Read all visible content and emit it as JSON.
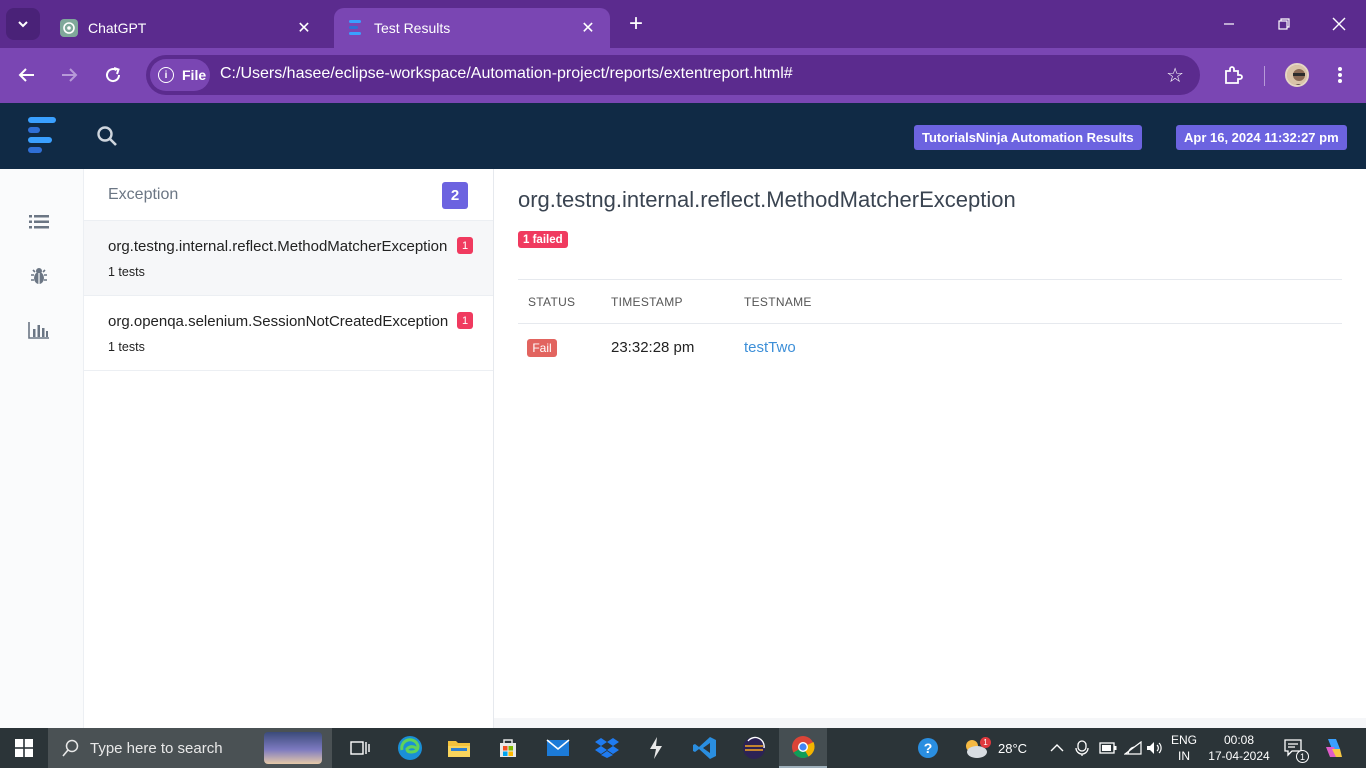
{
  "browser": {
    "tabs": [
      {
        "label": "ChatGPT",
        "active": false
      },
      {
        "label": "Test Results",
        "active": true
      }
    ],
    "site_chip": "File",
    "url": "C:/Users/hasee/eclipse-workspace/Automation-project/reports/extentreport.html#"
  },
  "header": {
    "report_name": "TutorialsNinja Automation Results",
    "timestamp": "Apr 16, 2024 11:32:27 pm"
  },
  "list": {
    "title": "Exception",
    "count": "2",
    "items": [
      {
        "name": "org.testng.internal.reflect.MethodMatcherException",
        "badge": "1",
        "sub": "1 tests"
      },
      {
        "name": "org.openqa.selenium.SessionNotCreatedException",
        "badge": "1",
        "sub": "1 tests"
      }
    ]
  },
  "detail": {
    "title": "org.testng.internal.reflect.MethodMatcherException",
    "failed_badge": "1 failed",
    "columns": [
      "STATUS",
      "TIMESTAMP",
      "TESTNAME"
    ],
    "rows": [
      {
        "status": "Fail",
        "timestamp": "23:32:28 pm",
        "testname": "testTwo"
      }
    ]
  },
  "taskbar": {
    "search_placeholder": "Type here to search",
    "weather_temp": "28°C",
    "weather_alert": "1",
    "lang_top": "ENG",
    "lang_bottom": "IN",
    "time": "00:08",
    "date": "17-04-2024",
    "notification_count": "1"
  },
  "colors": {
    "browser_frame": "#5b2b8e",
    "browser_toolbar": "#7a46b3",
    "app_header": "#102a45",
    "accent": "#6c63e0",
    "danger": "#f03a5f",
    "fail": "#e2645f",
    "link": "#3d8fd8"
  }
}
